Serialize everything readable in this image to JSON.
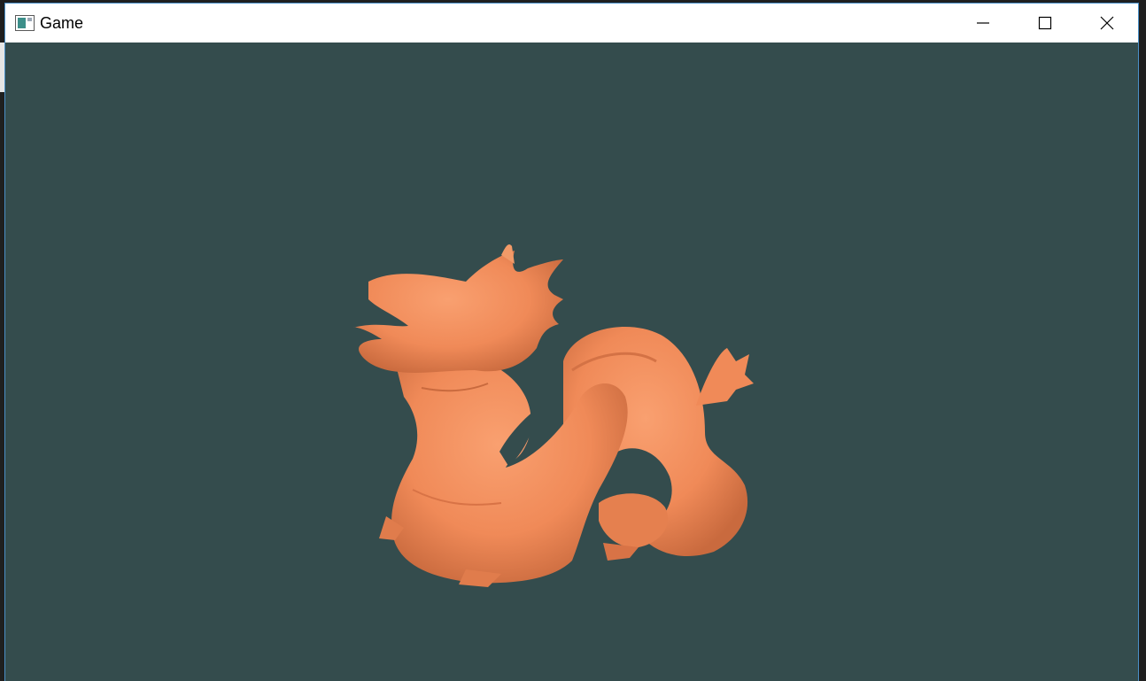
{
  "window": {
    "title": "Game",
    "icon": "app-window-icon",
    "controls": {
      "minimize_icon": "minimize-icon",
      "maximize_icon": "maximize-icon",
      "close_icon": "close-icon"
    }
  },
  "scene": {
    "background_color": "#344c4d",
    "model": "dragon",
    "model_color": "#f28c5e"
  },
  "colors": {
    "titlebar": "#ffffff",
    "window_border": "#4a90c8"
  }
}
